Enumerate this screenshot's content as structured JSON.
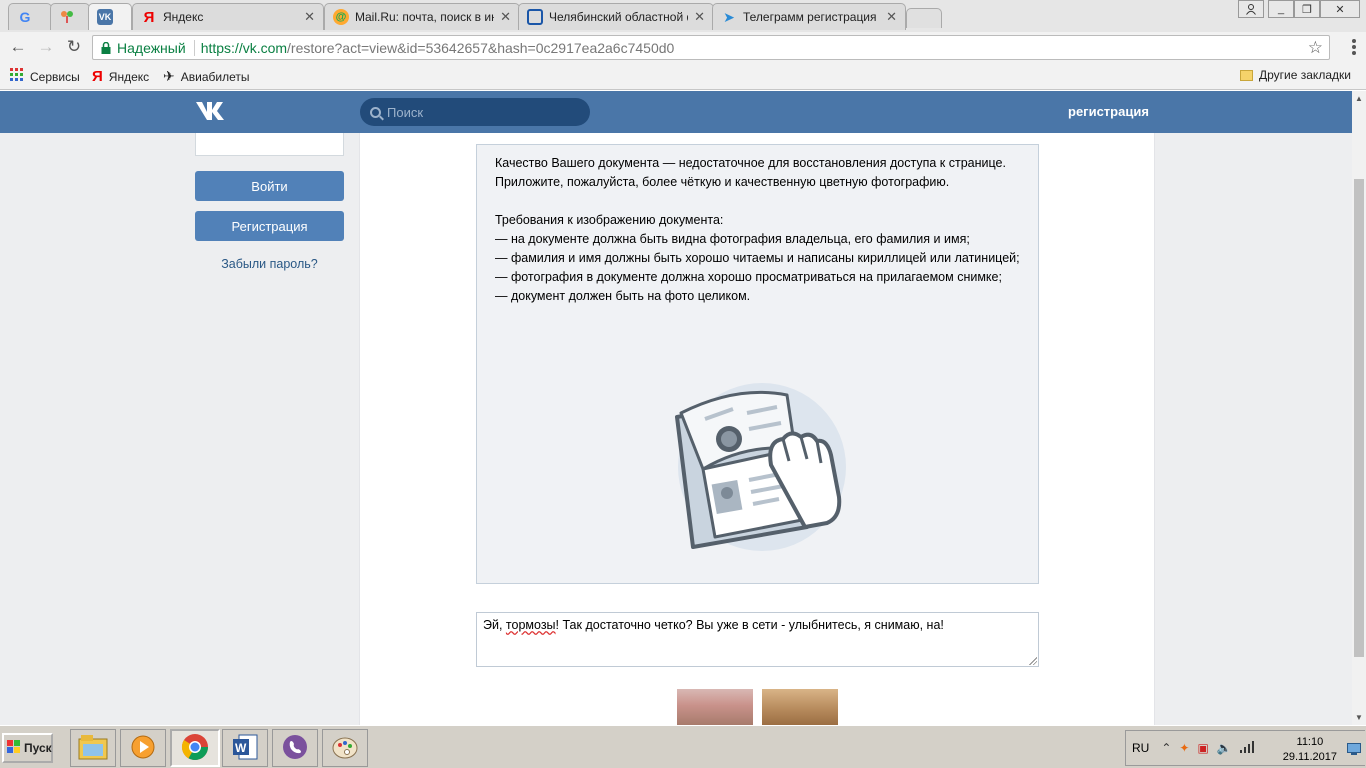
{
  "browser": {
    "tabs": [
      {
        "title": "",
        "favicon": "google-icon"
      },
      {
        "title": "",
        "favicon": "yandex-browser-icon"
      },
      {
        "title": "",
        "favicon": "vk-icon"
      },
      {
        "title": "Яндекс",
        "favicon": "yandex-icon"
      },
      {
        "title": "Mail.Ru: почта, поиск в ин",
        "favicon": "mailru-icon"
      },
      {
        "title": "Челябинский областной ф",
        "favicon": "document-icon"
      },
      {
        "title": "Телеграмм регистрация | ",
        "favicon": "telegram-icon"
      }
    ],
    "secure_label": "Надежный",
    "url_scheme_host": "https://vk.com",
    "url_path": "/restore?act=view&id=53642657&hash=0c2917ea2a6c7450d0",
    "bookmarks": [
      {
        "label": "Сервисы",
        "icon": "apps-grid-icon"
      },
      {
        "label": "Яндекс",
        "icon": "yandex-icon"
      },
      {
        "label": "Авиабилеты",
        "icon": "plane-icon"
      }
    ],
    "other_bookmarks": "Другие закладки"
  },
  "vk": {
    "search_placeholder": "Поиск",
    "register_link": "регистрация",
    "login_button": "Войти",
    "register_button": "Регистрация",
    "forgot_password": "Забыли пароль?",
    "notice_text": "Качество Вашего документа — недостаточное для восстановления доступа к странице. Приложите, пожалуйста, более чёткую и качественную цветную фотографию.\n\nТребования к изображению документа:\n— на документе должна быть видна фотография владельца, его фамилия и имя;\n— фамилия и имя должны быть хорошо читаемы и написаны кириллицей или латиницей;\n— фотография в документе должна хорошо просматриваться на прилагаемом снимке;\n— документ должен быть на фото целиком.",
    "comment_prefix": "Эй, ",
    "comment_typo": "тормозы",
    "comment_rest": "! Так достаточно четко? Вы уже в сети - улыбнитесь, я снимаю, на!"
  },
  "taskbar": {
    "start_label": "Пуск",
    "language": "RU",
    "time": "11:10",
    "date": "29.11.2017",
    "apps": [
      "file-manager-icon",
      "media-player-icon",
      "chrome-icon",
      "word-icon",
      "viber-icon",
      "paint-icon"
    ]
  },
  "colors": {
    "vk_blue": "#4a76a8",
    "vk_button": "#5181b8",
    "secure_green": "#0b8043"
  }
}
